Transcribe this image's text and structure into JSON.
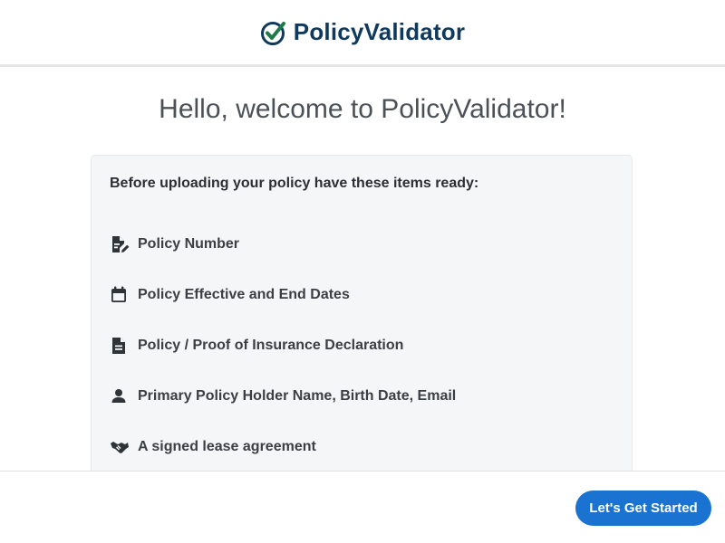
{
  "header": {
    "brand_name": "PolicyValidator",
    "brand_icon": "check-circle-icon",
    "brand_color": "#0f3a5e",
    "check_color": "#1f7a4a"
  },
  "main": {
    "welcome_title": "Hello, welcome to PolicyValidator!",
    "card_intro": "Before uploading your policy have these items ready:",
    "items": [
      {
        "icon": "document-edit-icon",
        "label": "Policy Number"
      },
      {
        "icon": "calendar-icon",
        "label": "Policy Effective and End Dates"
      },
      {
        "icon": "document-icon",
        "label": "Policy / Proof of Insurance Declaration"
      },
      {
        "icon": "person-icon",
        "label": "Primary Policy Holder Name, Birth Date, Email"
      },
      {
        "icon": "handshake-icon",
        "label": "A signed lease agreement"
      }
    ]
  },
  "footer": {
    "start_button_label": "Let's Get Started",
    "button_color": "#1a73d1"
  }
}
